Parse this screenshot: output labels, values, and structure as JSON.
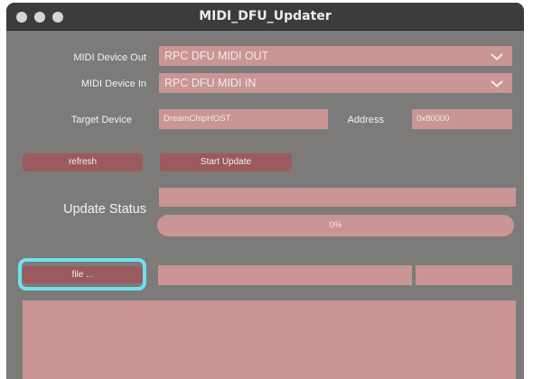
{
  "window": {
    "title": "MIDI_DFU_Updater"
  },
  "midi_out": {
    "label": "MIDI Device Out",
    "value": "RPC DFU MIDI OUT"
  },
  "midi_in": {
    "label": "MIDI Device In",
    "value": "RPC DFU MIDI IN"
  },
  "target": {
    "label": "Target Device",
    "value": "DreamChipHOST"
  },
  "address": {
    "label": "Address",
    "value": "0x80000"
  },
  "buttons": {
    "refresh": "refresh",
    "start_update": "Start Update",
    "file": "file ..."
  },
  "update_status": {
    "label": "Update Status",
    "status_text": "",
    "progress_text": "0%",
    "progress_fraction": 0
  },
  "file_info": {
    "path": "",
    "size": ""
  },
  "log": {
    "text": ""
  },
  "colors": {
    "window_bg": "#7c7b7a",
    "titlebar_bg": "#3d3c3c",
    "field_bg": "#c99595",
    "button_bg": "#9a5a5e",
    "focus_ring": "#6fe0ee"
  },
  "icons": {
    "dropdown": "chevron-down-icon",
    "window_controls": [
      "close-icon",
      "minimize-icon",
      "zoom-icon"
    ]
  }
}
